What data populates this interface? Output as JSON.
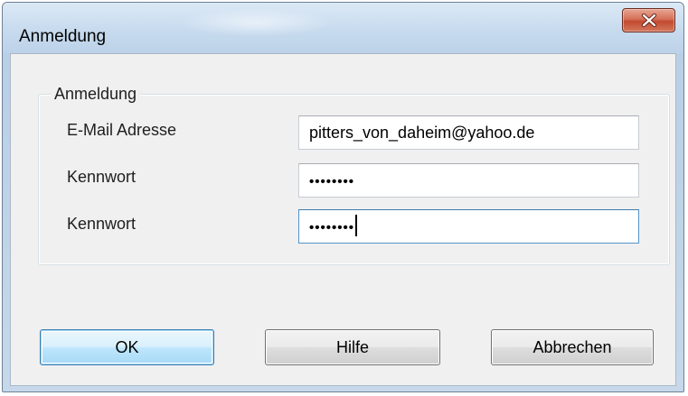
{
  "window": {
    "title": "Anmeldung"
  },
  "group": {
    "legend": "Anmeldung"
  },
  "fields": {
    "email_label": "E-Mail Adresse",
    "email_value": "pitters_von_daheim@yahoo.de",
    "password_label": "Kennwort",
    "password_value": "••••••••",
    "password_confirm_label": "Kennwort",
    "password_confirm_value": "••••••••"
  },
  "buttons": {
    "ok_label": "OK",
    "help_label": "Hilfe",
    "cancel_label": "Abbrechen"
  },
  "icons": {
    "close": "close-icon"
  },
  "colors": {
    "close_button": "#c9553b",
    "focus_border": "#5692c8",
    "default_button_border": "#3c7fb1"
  }
}
